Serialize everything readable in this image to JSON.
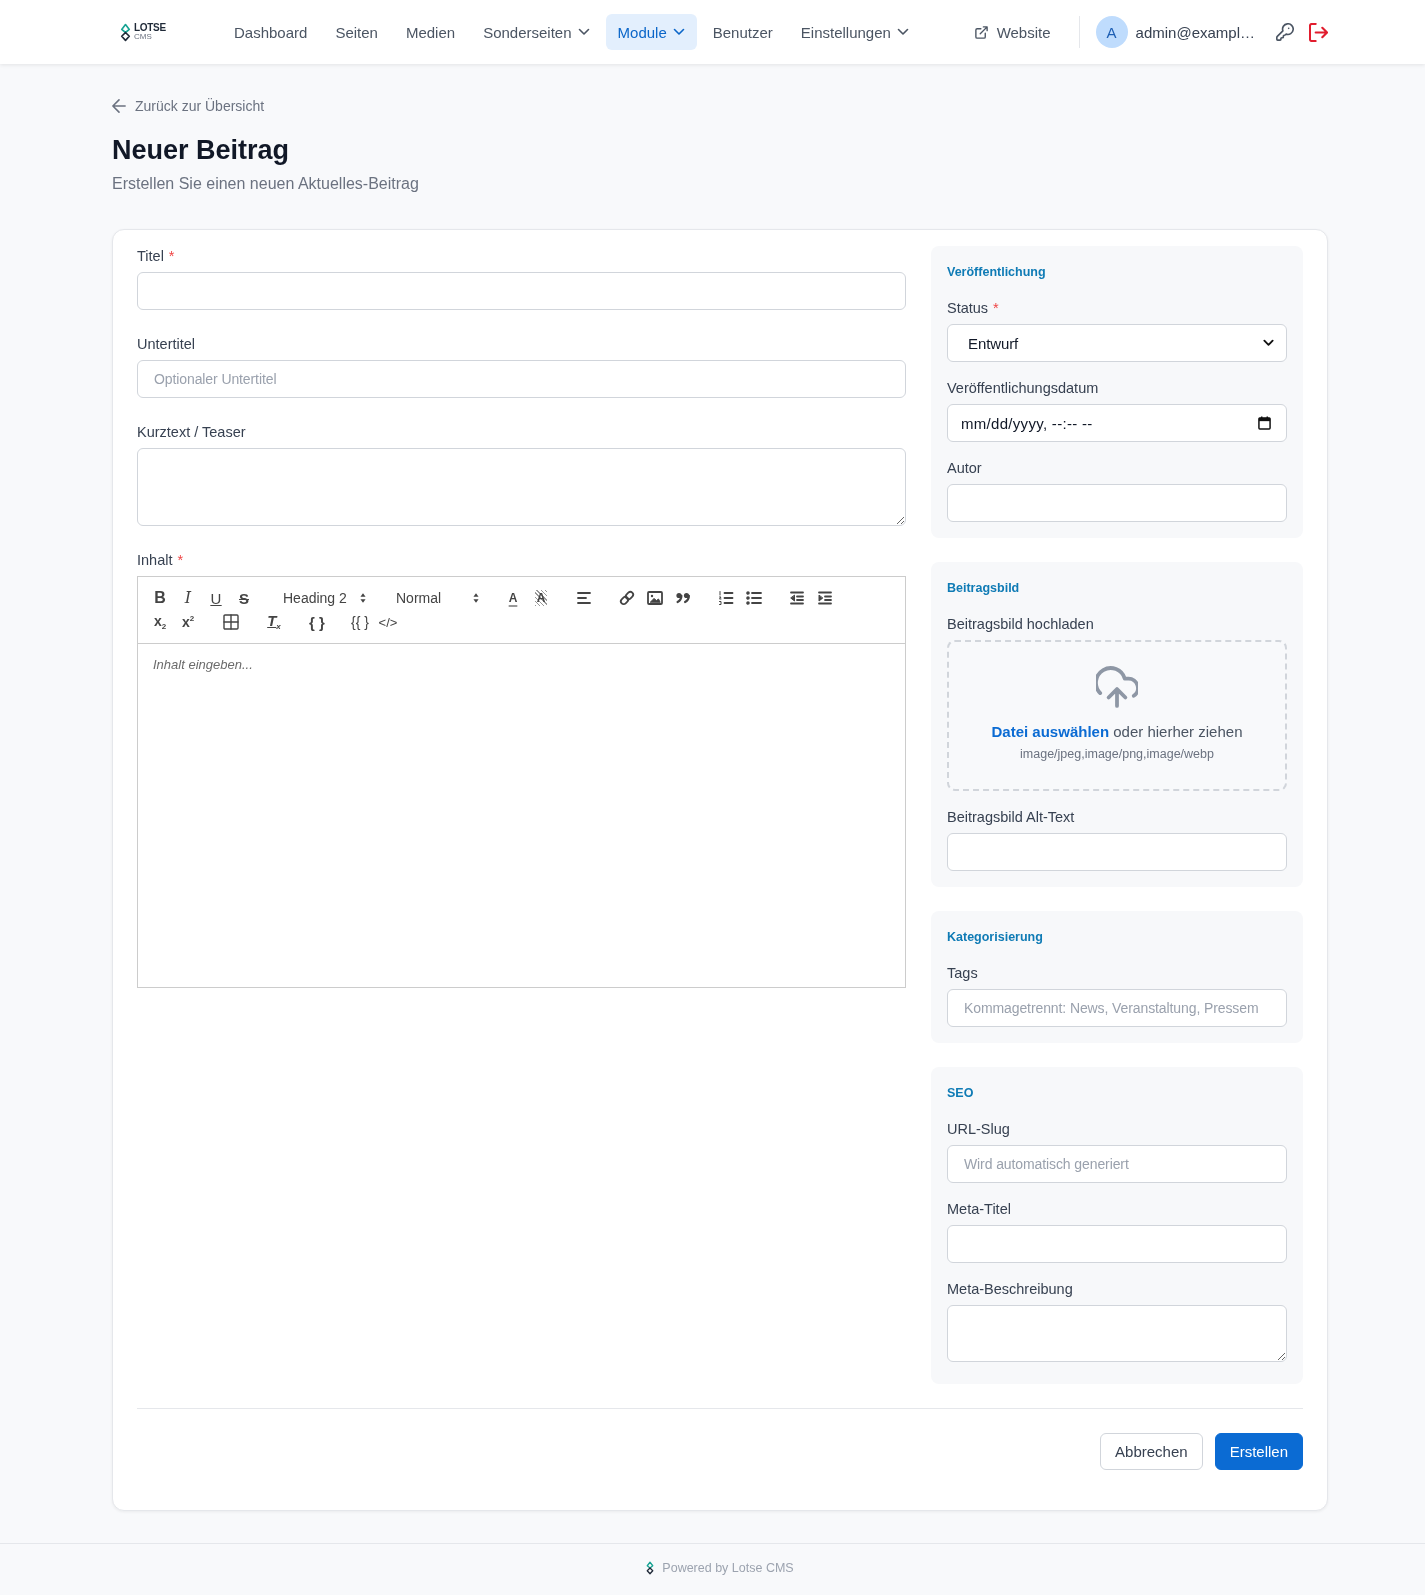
{
  "header": {
    "logo": {
      "name": "LOTSE",
      "subtitle": "CMS"
    },
    "nav": [
      {
        "label": "Dashboard",
        "dropdown": false,
        "selected": false
      },
      {
        "label": "Seiten",
        "dropdown": false,
        "selected": false
      },
      {
        "label": "Medien",
        "dropdown": false,
        "selected": false
      },
      {
        "label": "Sonderseiten",
        "dropdown": true,
        "selected": false
      },
      {
        "label": "Module",
        "dropdown": true,
        "selected": true
      },
      {
        "label": "Benutzer",
        "dropdown": false,
        "selected": false
      },
      {
        "label": "Einstellungen",
        "dropdown": true,
        "selected": false
      }
    ],
    "website_link": "Website",
    "user": {
      "initial": "A",
      "email": "admin@exampl…"
    }
  },
  "back_link": "Zurück zur Übersicht",
  "page_title": "Neuer Beitrag",
  "page_subtitle": "Erstellen Sie einen neuen Aktuelles-Beitrag",
  "main_fields": [
    {
      "kind": "input",
      "label": "Titel",
      "required_mark": "*"
    },
    {
      "kind": "input",
      "label": "Untertitel",
      "placeholder": "Optionaler Untertitel"
    },
    {
      "kind": "textarea",
      "label": "Kurztext / Teaser"
    },
    {
      "kind": "editor",
      "label": "Inhalt",
      "required_mark": "*",
      "placeholder": "Inhalt eingeben...",
      "toolbar": [
        {
          "items": [
            {
              "kind": "bold",
              "label": "B"
            },
            {
              "kind": "italic",
              "label": "I"
            },
            {
              "kind": "underline",
              "label": "U"
            },
            {
              "kind": "strike",
              "label": "S"
            }
          ]
        },
        {
          "items": [
            {
              "kind": "picker",
              "label": "Heading 2"
            }
          ]
        },
        {
          "items": [
            {
              "kind": "picker",
              "label": "Normal"
            }
          ]
        },
        {
          "items": [
            {
              "kind": "color",
              "label": "A"
            },
            {
              "kind": "background",
              "label": "A"
            }
          ]
        },
        {
          "items": [
            {
              "kind": "align"
            }
          ]
        },
        {
          "items": [
            {
              "kind": "link"
            },
            {
              "kind": "image"
            },
            {
              "kind": "quote"
            }
          ]
        },
        {
          "items": [
            {
              "kind": "olist"
            },
            {
              "kind": "ulist"
            }
          ]
        },
        {
          "items": [
            {
              "kind": "outdent"
            },
            {
              "kind": "indent"
            }
          ]
        },
        {
          "items": [
            {
              "kind": "sub",
              "label": "x$_{2}$"
            },
            {
              "kind": "sup",
              "label": "x$^{2}$"
            }
          ]
        },
        {
          "items": [
            {
              "kind": "table"
            }
          ]
        },
        {
          "items": [
            {
              "kind": "clean",
              "label": "T$_{x}$"
            }
          ]
        },
        {
          "items": [
            {
              "kind": "braces",
              "label": "{ }"
            }
          ]
        },
        {
          "items": [
            {
              "kind": "template",
              "label": "{{ }"
            },
            {
              "kind": "html",
              "label": "</>"
            }
          ]
        }
      ]
    }
  ],
  "sidebar": [
    {
      "title": "Veröffentlichung",
      "fields": [
        {
          "kind": "select",
          "label": "Status",
          "required_mark": "*",
          "value": "Entwurf"
        },
        {
          "kind": "datetime",
          "label": "Veröffentlichungsdatum",
          "value": "mm/dd/yyyy, --:-- --"
        },
        {
          "kind": "input",
          "label": "Autor"
        }
      ]
    },
    {
      "title": "Beitragsbild",
      "fields": [
        {
          "kind": "upload",
          "label": "Beitragsbild hochladen",
          "link": "Datei auswählen",
          "text": "oder hierher ziehen",
          "hint": "image/jpeg,image/png,image/webp"
        },
        {
          "kind": "input",
          "label": "Beitragsbild Alt-Text"
        }
      ]
    },
    {
      "title": "Kategorisierung",
      "fields": [
        {
          "kind": "input",
          "label": "Tags",
          "placeholder": "Kommagetrennt: News, Veranstaltung, Pressem"
        }
      ]
    },
    {
      "title": "SEO",
      "fields": [
        {
          "kind": "input",
          "label": "URL-Slug",
          "placeholder": "Wird automatisch generiert"
        },
        {
          "kind": "input",
          "label": "Meta-Titel"
        },
        {
          "kind": "textarea",
          "label": "Meta-Beschreibung"
        }
      ]
    }
  ],
  "actions": [
    {
      "kind": "secondary",
      "label": "Abbrechen"
    },
    {
      "kind": "primary",
      "label": "Erstellen"
    }
  ],
  "footer": "Powered by Lotse CMS"
}
